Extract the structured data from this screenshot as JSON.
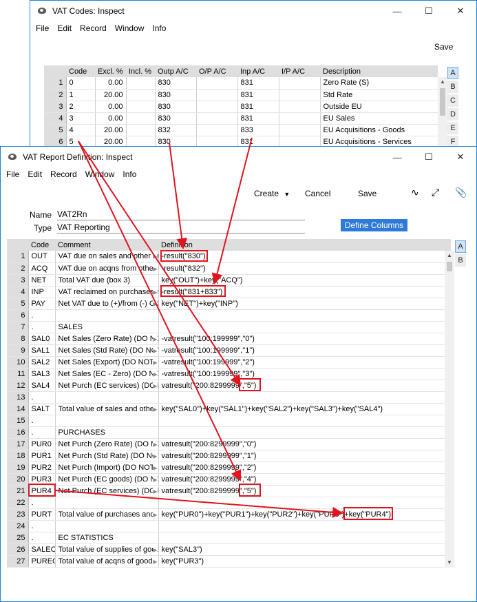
{
  "vat_codes": {
    "title": "VAT Codes: Inspect",
    "menu": [
      "File",
      "Edit",
      "Record",
      "Window",
      "Info"
    ],
    "save_label": "Save",
    "columns": [
      "Code",
      "Excl. %",
      "Incl. %",
      "Outp A/C",
      "O/P A/C",
      "Inp A/C",
      "I/P A/C",
      "Description"
    ],
    "rows": [
      {
        "n": "1",
        "code": "0",
        "excl": "0.00",
        "incl": "",
        "outp": "830",
        "op": "",
        "inp": "831",
        "ip": "",
        "desc": "Zero Rate (S)"
      },
      {
        "n": "2",
        "code": "1",
        "excl": "20.00",
        "incl": "",
        "outp": "830",
        "op": "",
        "inp": "831",
        "ip": "",
        "desc": "Std Rate"
      },
      {
        "n": "3",
        "code": "2",
        "excl": "0.00",
        "incl": "",
        "outp": "830",
        "op": "",
        "inp": "831",
        "ip": "",
        "desc": "Outside EU"
      },
      {
        "n": "4",
        "code": "3",
        "excl": "0.00",
        "incl": "",
        "outp": "830",
        "op": "",
        "inp": "831",
        "ip": "",
        "desc": "EU Sales"
      },
      {
        "n": "5",
        "code": "4",
        "excl": "20.00",
        "incl": "",
        "outp": "832",
        "op": "",
        "inp": "833",
        "ip": "",
        "desc": "EU Acquisitions - Goods"
      },
      {
        "n": "6",
        "code": "5",
        "excl": "20.00",
        "incl": "",
        "outp": "830",
        "op": "",
        "inp": "831",
        "ip": "",
        "desc": "EU Acquisitions - Services"
      }
    ],
    "side_tabs": [
      "A",
      "B",
      "C",
      "D",
      "E",
      "F"
    ]
  },
  "vat_report": {
    "title": "VAT Report Definition: Inspect",
    "menu": [
      "File",
      "Edit",
      "Record",
      "Window",
      "Info"
    ],
    "toolbar": {
      "create": "Create",
      "cancel": "Cancel",
      "save": "Save"
    },
    "name_label": "Name",
    "name_value": "VAT2Rn",
    "type_label": "Type",
    "type_value": "VAT Reporting",
    "define_columns": "Define Columns",
    "columns": [
      "Code",
      "Comment",
      "Definition"
    ],
    "side_tabs": [
      "A",
      "B"
    ],
    "rows": [
      {
        "n": "1",
        "code": "OUT",
        "comment": "VAT due on sales and other ou",
        "def": "-result(\"830\")"
      },
      {
        "n": "2",
        "code": "ACQ",
        "comment": "VAT due on acqns from other EC",
        "def": "-result(\"832\")"
      },
      {
        "n": "3",
        "code": "NET",
        "comment": "Total VAT due (box 3)",
        "def": "key(\"OUT\")+key(\"ACQ\")"
      },
      {
        "n": "4",
        "code": "INP",
        "comment": "VAT reclaimed on purchases and",
        "def": "-result(\"831+833\")"
      },
      {
        "n": "5",
        "code": "PAY",
        "comment": "Net VAT due to (+)/from (-) C&E",
        "def": "key(\"NET\")+key(\"INP\")"
      },
      {
        "n": "6",
        "code": ".",
        "comment": "",
        "def": ""
      },
      {
        "n": "7",
        "code": ".",
        "comment": "SALES",
        "def": ""
      },
      {
        "n": "8",
        "code": "SAL0",
        "comment": "Net Sales (Zero Rate)  (DO NOT",
        "def": "-vatresult(\"100:199999\",\"0\")"
      },
      {
        "n": "9",
        "code": "SAL1",
        "comment": "Net Sales (Std Rate)  (DO NOT",
        "def": "-vatresult(\"100:199999\",\"1\")"
      },
      {
        "n": "10",
        "code": "SAL2",
        "comment": "Net Sales (Export)  (DO NOT",
        "def": "-vatresult(\"100:199999\",\"2\")"
      },
      {
        "n": "11",
        "code": "SAL3",
        "comment": "Net Sales (EC - Zero)  (DO NOT",
        "def": "-vatresult(\"100:199999\",\"3\")"
      },
      {
        "n": "12",
        "code": "SAL4",
        "comment": "Net Purch (EC services)  (DO NO",
        "def": "vatresult(\"200:8299999\",\"5\")"
      },
      {
        "n": "13",
        "code": ".",
        "comment": "",
        "def": ""
      },
      {
        "n": "14",
        "code": "SALT",
        "comment": "Total value of sales and other",
        "def": "key(\"SAL0\")+key(\"SAL1\")+key(\"SAL2\")+key(\"SAL3\")+key(\"SAL4\")"
      },
      {
        "n": "15",
        "code": ".",
        "comment": "",
        "def": ""
      },
      {
        "n": "16",
        "code": ".",
        "comment": "PURCHASES",
        "def": ""
      },
      {
        "n": "17",
        "code": "PUR0",
        "comment": "Net Purch (Zero Rate)  (DO NOT",
        "def": "vatresult(\"200:8299999\",\"0\")"
      },
      {
        "n": "18",
        "code": "PUR1",
        "comment": "Net Purch (Std Rate)  (DO NOT",
        "def": "vatresult(\"200:8299999\",\"1\")"
      },
      {
        "n": "19",
        "code": "PUR2",
        "comment": "Net Purch (Import)  (DO NOT",
        "def": "vatresult(\"200:8299999\",\"2\")"
      },
      {
        "n": "20",
        "code": "PUR3",
        "comment": "Net Purch (EC goods)  (DO NOT",
        "def": "vatresult(\"200:8299999\",\"4\")"
      },
      {
        "n": "21",
        "code": "PUR4",
        "comment": "Net Purch (EC services)  (DO NO",
        "def": "vatresult(\"200:8299999\",\"5\")"
      },
      {
        "n": "22",
        "code": ".",
        "comment": "",
        "def": ""
      },
      {
        "n": "23",
        "code": "PURT",
        "comment": "Total value of purchases and",
        "def": "key(\"PUR0\")+key(\"PUR1\")+key(\"PUR2\")+key(\"PUR3\")+key(\"PUR4\")"
      },
      {
        "n": "24",
        "code": ".",
        "comment": "",
        "def": ""
      },
      {
        "n": "25",
        "code": ".",
        "comment": "EC STATISTICS",
        "def": ""
      },
      {
        "n": "26",
        "code": "SALEC",
        "comment": "Total value of supplies of goods",
        "def": "key(\"SAL3\")"
      },
      {
        "n": "27",
        "code": "PUREC",
        "comment": "Total value of acqns of goods",
        "def": "key(\"PUR3\")"
      }
    ]
  },
  "colors": {
    "accent": "#1883d7",
    "highlight": "#e0141e",
    "button": "#2d7bd6"
  }
}
